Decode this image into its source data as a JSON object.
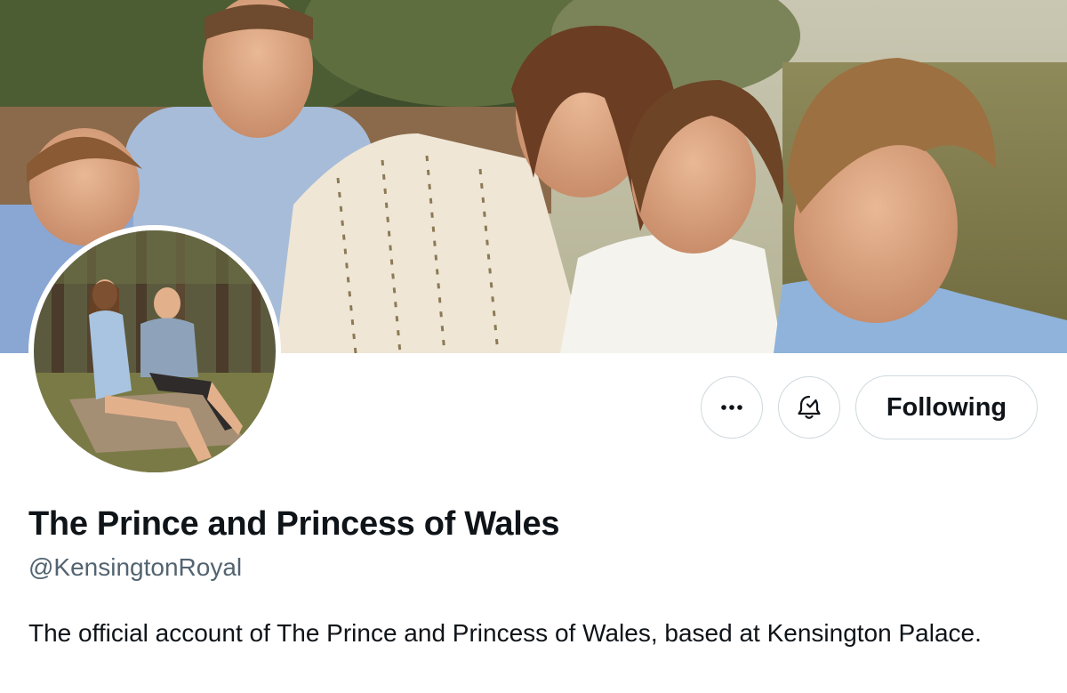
{
  "profile": {
    "display_name": "The Prince and Princess of Wales",
    "handle": "@KensingtonRoyal",
    "bio": "The official account of The Prince and Princess of Wales, based at Kensington Palace."
  },
  "actions": {
    "more_icon": "more-icon",
    "notifications_icon": "bell-icon",
    "follow_label": "Following"
  },
  "colors": {
    "text_primary": "#0f1419",
    "text_secondary": "#536471",
    "button_border": "#cfd9de"
  }
}
